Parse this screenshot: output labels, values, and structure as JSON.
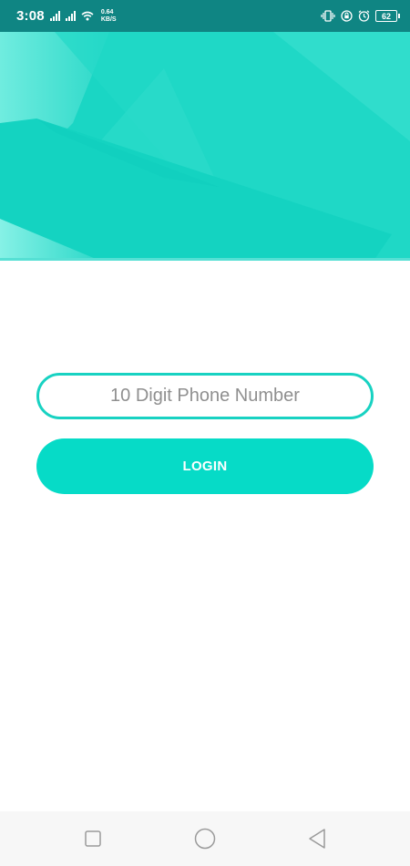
{
  "status_bar": {
    "time": "3:08",
    "network_speed_value": "0.64",
    "network_speed_unit": "KB/S",
    "battery_level": "62",
    "icons": [
      "signal-icon",
      "signal-icon",
      "wifi-icon",
      "vibrate-icon",
      "lock-rotation-icon",
      "alarm-icon",
      "battery-icon"
    ]
  },
  "header": {
    "colors": {
      "base": "#1ad6c4",
      "light": "#7ff0e4",
      "accent": "#06dbc7"
    }
  },
  "login_form": {
    "phone_placeholder": "10 Digit Phone Number",
    "phone_value": "",
    "login_label": "LOGIN"
  },
  "nav_bar": {
    "buttons": [
      "recent-apps-icon",
      "home-icon",
      "back-icon"
    ]
  }
}
